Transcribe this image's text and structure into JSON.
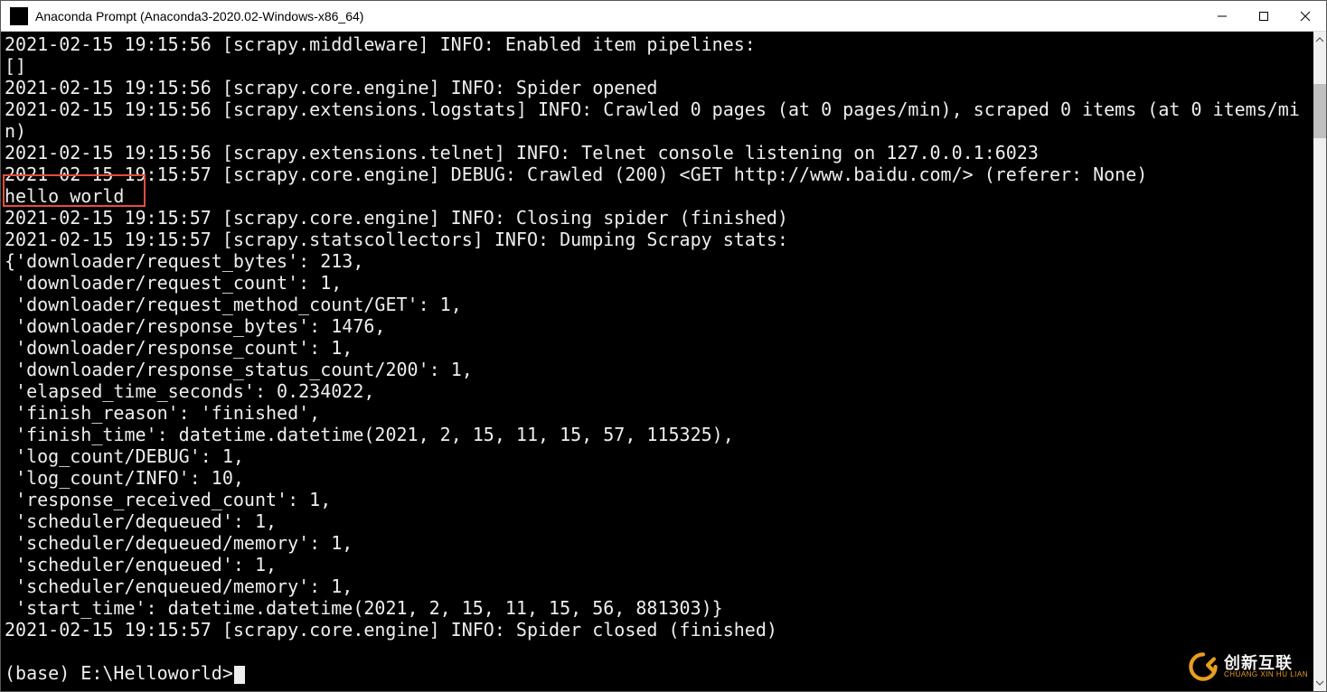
{
  "window": {
    "title": "Anaconda Prompt (Anaconda3-2020.02-Windows-x86_64)"
  },
  "terminal": {
    "lines": [
      "2021-02-15 19:15:56 [scrapy.middleware] INFO: Enabled item pipelines:",
      "[]",
      "2021-02-15 19:15:56 [scrapy.core.engine] INFO: Spider opened",
      "2021-02-15 19:15:56 [scrapy.extensions.logstats] INFO: Crawled 0 pages (at 0 pages/min), scraped 0 items (at 0 items/min)",
      "2021-02-15 19:15:56 [scrapy.extensions.telnet] INFO: Telnet console listening on 127.0.0.1:6023",
      "2021-02-15 19:15:57 [scrapy.core.engine] DEBUG: Crawled (200) <GET http://www.baidu.com/> (referer: None)",
      "hello world",
      "2021-02-15 19:15:57 [scrapy.core.engine] INFO: Closing spider (finished)",
      "2021-02-15 19:15:57 [scrapy.statscollectors] INFO: Dumping Scrapy stats:",
      "{'downloader/request_bytes': 213,",
      " 'downloader/request_count': 1,",
      " 'downloader/request_method_count/GET': 1,",
      " 'downloader/response_bytes': 1476,",
      " 'downloader/response_count': 1,",
      " 'downloader/response_status_count/200': 1,",
      " 'elapsed_time_seconds': 0.234022,",
      " 'finish_reason': 'finished',",
      " 'finish_time': datetime.datetime(2021, 2, 15, 11, 15, 57, 115325),",
      " 'log_count/DEBUG': 1,",
      " 'log_count/INFO': 10,",
      " 'response_received_count': 1,",
      " 'scheduler/dequeued': 1,",
      " 'scheduler/dequeued/memory': 1,",
      " 'scheduler/enqueued': 1,",
      " 'scheduler/enqueued/memory': 1,",
      " 'start_time': datetime.datetime(2021, 2, 15, 11, 15, 56, 881303)}",
      "2021-02-15 19:15:57 [scrapy.core.engine] INFO: Spider closed (finished)",
      "",
      "(base) E:\\Helloworld>"
    ],
    "highlight_line_index": 6
  },
  "watermark": {
    "main": "创新互联",
    "sub": "CHUANG XIN HU LIAN"
  }
}
